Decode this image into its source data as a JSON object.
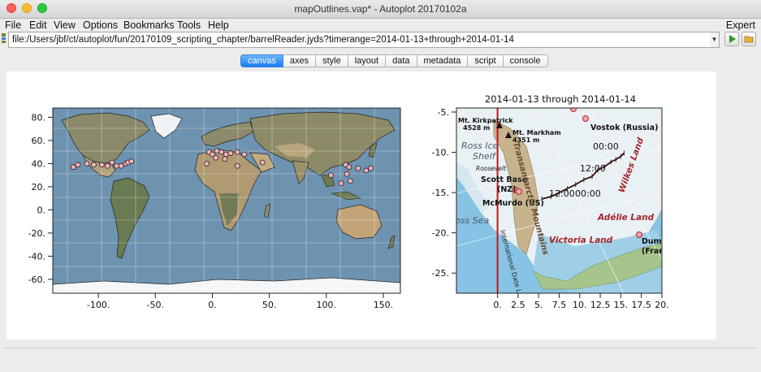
{
  "window": {
    "title": "mapOutlines.vap* - Autoplot 20170102a"
  },
  "menu": {
    "items": [
      "File",
      "Edit",
      "View",
      "Options",
      "Bookmarks",
      "Tools",
      "Help"
    ],
    "right": "Expert"
  },
  "url": {
    "value": "file:/Users/jbf/ct/autoplot/fun/20170109_scripting_chapter/barrelReader.jyds?timerange=2014-01-13+through+2014-01-14"
  },
  "tabs": [
    "canvas",
    "axes",
    "style",
    "layout",
    "data",
    "metadata",
    "script",
    "console"
  ],
  "active_tab": "canvas",
  "chart_data": [
    {
      "type": "scatter",
      "xlim": [
        -140,
        165
      ],
      "ylim": [
        -72,
        88
      ],
      "xticks": [
        -100,
        -50,
        0,
        50,
        100,
        150
      ],
      "yticks": [
        80,
        60,
        40,
        20,
        0,
        -20,
        -40,
        -60
      ],
      "xtick_labels": [
        "-100.",
        "-50.",
        "0.",
        "50.",
        "100.",
        "150."
      ],
      "ytick_labels": [
        "80.",
        "60.",
        "40.",
        "20.",
        "0.",
        "-20.",
        "-40.",
        "-60."
      ],
      "background": "world map",
      "points_color": "#f2b0b7",
      "points": [
        [
          -122,
          37
        ],
        [
          -118,
          39
        ],
        [
          -110,
          40
        ],
        [
          -104,
          39
        ],
        [
          -97,
          39
        ],
        [
          -92,
          38
        ],
        [
          -88,
          41
        ],
        [
          -84,
          38
        ],
        [
          -80,
          38
        ],
        [
          -76,
          40
        ],
        [
          -74,
          41
        ],
        [
          -71,
          42
        ],
        [
          -3,
          50
        ],
        [
          0,
          48
        ],
        [
          4,
          51
        ],
        [
          8,
          50
        ],
        [
          12,
          48
        ],
        [
          16,
          49
        ],
        [
          22,
          50
        ],
        [
          28,
          48
        ],
        [
          3,
          45
        ],
        [
          11,
          44
        ],
        [
          -5,
          40
        ],
        [
          22,
          38
        ],
        [
          44,
          41
        ],
        [
          117,
          39
        ],
        [
          120,
          37
        ],
        [
          118,
          31
        ],
        [
          121,
          25
        ],
        [
          113,
          23
        ],
        [
          104,
          30
        ],
        [
          128,
          36
        ],
        [
          139,
          36
        ],
        [
          135,
          34
        ]
      ]
    },
    {
      "type": "line",
      "title": "2014-01-13 through 2014-01-14",
      "xlim": [
        -5,
        20
      ],
      "ylim": [
        -27.5,
        -4.5
      ],
      "xticks": [
        0,
        2.5,
        5,
        7.5,
        10,
        12.5,
        15,
        17.5,
        20
      ],
      "yticks": [
        -5,
        -10,
        -15,
        -20,
        -25
      ],
      "xtick_labels": [
        "0.",
        "2.5",
        "5.",
        "7.5",
        "10.",
        "12.5",
        "15.",
        "17.5",
        "20."
      ],
      "ytick_labels": [
        "-5.",
        "-10.",
        "-15.",
        "-20.",
        "-25."
      ],
      "background": "Antarctica map",
      "map_labels": [
        "Mt. Kirkpatrick",
        "4528 m",
        "Mt. Markham",
        "4351 m",
        "Vostok (Russia)",
        "Ross Ice",
        "Shelf",
        "Roosevelt",
        "Scott Base",
        "(NZ)",
        "McMurdo (US)",
        "oss Sea",
        "Adélie Land",
        "Victoria Land",
        "Dumo",
        "(Franc",
        "Wilkes Land",
        "Transantarctic Mountains",
        "International Date L"
      ],
      "time_labels": [
        "00:00",
        "12:00",
        "12:00",
        "00:00"
      ],
      "track_x": [
        5.4,
        6.5,
        7.5,
        8.5,
        9.5,
        10.5,
        11.5,
        12.2,
        13.0,
        13.8,
        14.4,
        15.0,
        15.4
      ],
      "track_y": [
        -15.8,
        -15.5,
        -15.0,
        -14.5,
        -14.0,
        -13.4,
        -13.0,
        -12.2,
        -11.8,
        -11.2,
        -10.9,
        -10.5,
        -10.1
      ],
      "line_color": "#3a1e1e",
      "date_line_color": "#c0181b"
    }
  ]
}
